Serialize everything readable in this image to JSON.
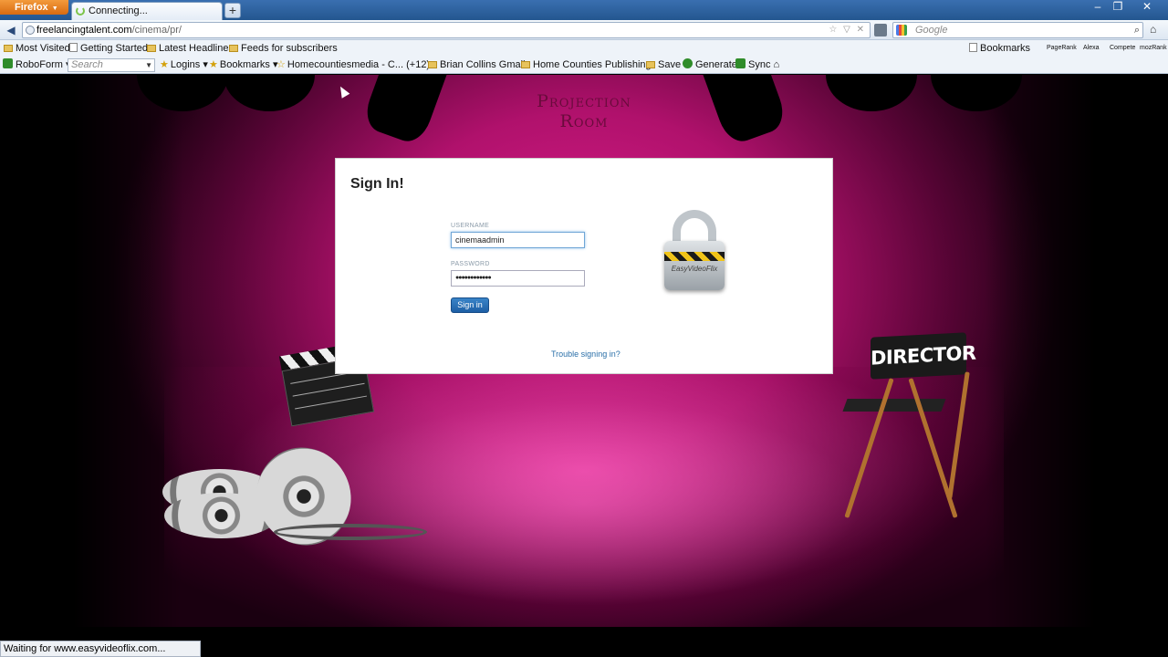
{
  "browser": {
    "app_button": "Firefox",
    "tab": {
      "title": "Connecting..."
    },
    "new_tab": "+",
    "window_controls": [
      "–",
      "❐",
      "✕"
    ],
    "url": {
      "host": "freelancingtalent.com",
      "path": "/cinema/pr/"
    },
    "search": {
      "placeholder": "Google"
    },
    "bookmarks_bar": [
      "Most Visited",
      "Getting Started",
      "Latest Headlines",
      "Feeds for subscribers"
    ],
    "bookmarks_right": [
      "Bookmarks",
      "PageRank",
      "Alexa",
      "Compete",
      "mozRank"
    ],
    "toolbar": {
      "roboform": "RoboForm",
      "search_placeholder": "Search",
      "logins": "Logins",
      "bookmarks": "Bookmarks",
      "homecounties": "Homecountiesmedia - C...",
      "homecounties_count": "(+12)",
      "brian": "Brian Collins Gmail",
      "publishing": "Home Counties Publishing",
      "save": "Save",
      "generate": "Generate",
      "sync": "Sync"
    },
    "status": "Waiting for www.easyvideoflix.com..."
  },
  "stage": {
    "title": "Projection Room",
    "director_label": "DIRECTOR"
  },
  "signin": {
    "title": "Sign In!",
    "username_label": "USERNAME",
    "username_value": "cinemaadmin",
    "password_label": "PASSWORD",
    "password_value": "●●●●●●●●●●●●",
    "submit_label": "Sign in",
    "trouble_link": "Trouble signing in?",
    "lock_brand": "EasyVideoFlix"
  },
  "colors": {
    "stage_pink": "#e0208e",
    "accent_blue": "#1d5fa5",
    "firefox_orange": "#e47a1f"
  }
}
